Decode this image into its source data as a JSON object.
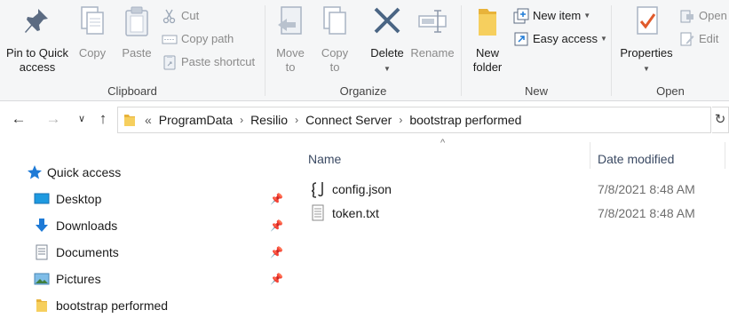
{
  "ribbon": {
    "clipboard": {
      "label": "Clipboard",
      "pin": "Pin to Quick\naccess",
      "copy": "Copy",
      "paste": "Paste",
      "cut": "Cut",
      "copy_path": "Copy path",
      "paste_shortcut": "Paste shortcut"
    },
    "organize": {
      "label": "Organize",
      "move_to": "Move\nto",
      "copy_to": "Copy\nto",
      "delete": "Delete",
      "rename": "Rename"
    },
    "new": {
      "label": "New",
      "new_folder": "New\nfolder",
      "new_item": "New item",
      "easy_access": "Easy access"
    },
    "open": {
      "label": "Open",
      "properties": "Properties",
      "open": "Open",
      "edit": "Edit"
    }
  },
  "address": {
    "overflow": "«",
    "crumbs": [
      "ProgramData",
      "Resilio",
      "Connect Server",
      "bootstrap performed"
    ],
    "separator": "›"
  },
  "nav": {
    "items": [
      {
        "label": "Quick access",
        "icon": "star-icon",
        "pinned": false
      },
      {
        "label": "Desktop",
        "icon": "desktop-icon",
        "pinned": true
      },
      {
        "label": "Downloads",
        "icon": "download-icon",
        "pinned": true
      },
      {
        "label": "Documents",
        "icon": "documents-icon",
        "pinned": true
      },
      {
        "label": "Pictures",
        "icon": "pictures-icon",
        "pinned": true
      },
      {
        "label": "bootstrap performed",
        "icon": "folder-icon",
        "pinned": false
      }
    ]
  },
  "files": {
    "columns": {
      "name": "Name",
      "date": "Date modified"
    },
    "rows": [
      {
        "name": "config.json",
        "date": "7/8/2021 8:48 AM",
        "icon": "json-file-icon"
      },
      {
        "name": "token.txt",
        "date": "7/8/2021 8:48 AM",
        "icon": "text-file-icon"
      }
    ]
  },
  "colors": {
    "ribbon_bg": "#f5f6f7",
    "accent_blue": "#1e7ad6",
    "folder_yellow": "#f2c94c",
    "delete_blue": "#4a6584",
    "properties_red": "#e05a2b"
  }
}
